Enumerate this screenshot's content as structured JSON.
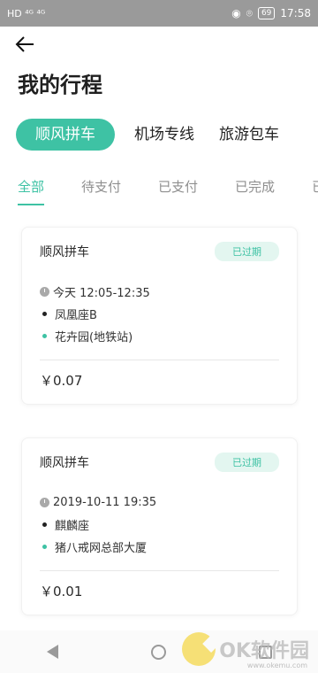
{
  "status_bar": {
    "left_text": "HD ⁴ᴳ ⁴ᴳ ",
    "battery": "69",
    "time": "17:58"
  },
  "page": {
    "title": "我的行程"
  },
  "category_tabs": [
    {
      "label": "顺风拼车",
      "active": true
    },
    {
      "label": "机场专线",
      "active": false
    },
    {
      "label": "旅游包车",
      "active": false
    }
  ],
  "status_tabs": [
    {
      "label": "全部",
      "active": true
    },
    {
      "label": "待支付",
      "active": false
    },
    {
      "label": "已支付",
      "active": false
    },
    {
      "label": "已完成",
      "active": false
    },
    {
      "label": "已",
      "active": false
    }
  ],
  "trips": [
    {
      "title": "顺风拼车",
      "status": "已过期",
      "time": "今天 12:05-12:35",
      "from": "凤凰座B",
      "to": "花卉园(地铁站)",
      "price": "￥0.07"
    },
    {
      "title": "顺风拼车",
      "status": "已过期",
      "time": "2019-10-11 19:35",
      "from": "麒麟座",
      "to": "猪八戒网总部大厦",
      "price": "￥0.01"
    }
  ],
  "watermark": {
    "text": "OK软件园",
    "sub": "www.okemu.com"
  },
  "colors": {
    "accent": "#3ec2a4",
    "badge_bg": "#e3f6f0"
  }
}
